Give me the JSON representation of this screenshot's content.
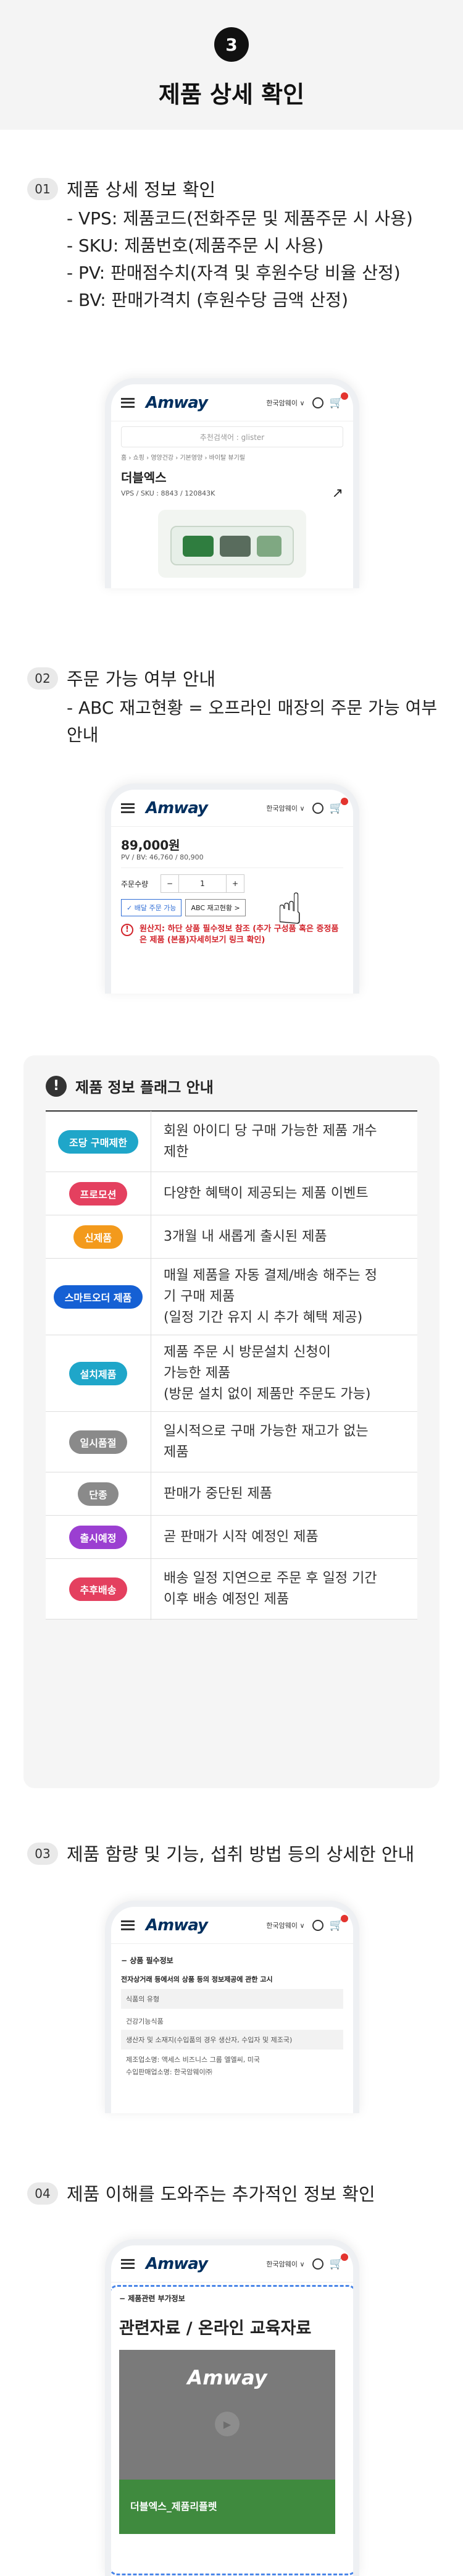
{
  "header": {
    "step": "3",
    "title": "제품 상세 확인"
  },
  "sec1": {
    "num": "01",
    "title": "제품 상세 정보 확인",
    "bullets": [
      "- VPS: 제품코드(전화주문 및 제품주문 시 사용)",
      "- SKU: 제품번호(제품주문 시 사용)",
      "- PV: 판매점수치(자격 및 후원수당 비율 산정)",
      "- BV: 판매가격치 (후원수당 금액 산정)"
    ],
    "phone": {
      "logo": "Amway",
      "lang": "한국암웨이 ∨",
      "search_placeholder": "추천검색어 : glister",
      "breadcrumb": "홈 › 쇼핑 › 영양건강 › 기본영양 › 바이탈 뷰기릴",
      "product_name": "더블엑스",
      "codes": "VPS / SKU : 8843 / 120843K"
    }
  },
  "sec2": {
    "num": "02",
    "title": "주문 가능 여부 안내",
    "bullets": [
      "- ABC 재고현황 = 오프라인 매장의 주문 가능 여부",
      "안내"
    ],
    "phone": {
      "logo": "Amway",
      "lang": "한국암웨이 ∨",
      "price": "89,000원",
      "pvbv": "PV / BV: 46,760 / 80,900",
      "qty_label": "주문수량",
      "minus": "−",
      "qty": "1",
      "plus": "+",
      "delivery": "✓ 배달 주문 가능",
      "abc_btn": "ABC 재고현황 >",
      "notice": "원산지: 하단 상품 필수정보 참조 (추가 구성품 혹은 증정품은 제품 (본품)자세히보기 링크 확인)"
    }
  },
  "flags": {
    "title": "제품 정보 플래그 안내",
    "rows": [
      {
        "label": "조당 구매제한",
        "color": "#1fa6c9",
        "desc": [
          "회원 아이디 당 구매 가능한 제품 개수",
          "제한"
        ]
      },
      {
        "label": "프로모션",
        "color": "#e4405f",
        "desc": [
          "다양한 혜택이 제공되는 제품 이벤트"
        ]
      },
      {
        "label": "신제품",
        "color": "#f39a1c",
        "desc": [
          "3개월 내 새롭게 출시된 제품"
        ]
      },
      {
        "label": "스마트오더 제품",
        "color": "#1560d4",
        "desc": [
          "매월 제품을 자동 결제/배송 해주는 정",
          "기 구매 제품",
          "(일정 기간 유지 시 추가 혜택 제공)"
        ]
      },
      {
        "label": "설치제품",
        "color": "#1fa6c9",
        "desc": [
          "제품 주문 시 방문설치 신청이",
          "가능한 제품",
          "(방문 설치 없이 제품만 주문도 가능)"
        ]
      },
      {
        "label": "일시품절",
        "color": "#8a8a8a",
        "desc": [
          "일시적으로 구매 가능한 재고가 없는",
          "제품"
        ]
      },
      {
        "label": "단종",
        "color": "#8a8a8a",
        "desc": [
          "판매가 중단된 제품"
        ]
      },
      {
        "label": "출시예정",
        "color": "#9b3fd1",
        "desc": [
          "곧 판매가 시작 예정인 제품"
        ]
      },
      {
        "label": "추후배송",
        "color": "#e4405f",
        "desc": [
          "배송 일정 지연으로 주문 후 일정 기간",
          "이후 배송 예정인 제품"
        ]
      }
    ]
  },
  "sec3": {
    "num": "03",
    "title": "제품 함량 및 기능, 섭취 방법 등의 상세한 안내",
    "phone": {
      "logo": "Amway",
      "lang": "한국암웨이 ∨",
      "acc_title": "− 상품 필수정보",
      "notice_title": "전자상거래 등에서의 상품 등의 정보제공에 관한 고시",
      "rows": [
        "식품의 유형",
        "건강기능식품",
        "생산자 및 소재지(수입품의 경우 생산자, 수입자 및 제조국)",
        "제조업소명: 액세스 비즈니스 그룹 엘엘씨, 미국",
        "수입판매업소명: 한국암웨이㈜"
      ]
    }
  },
  "sec4": {
    "num": "04",
    "title": "제품 이해를 도와주는 추가적인 정보 확인",
    "phone": {
      "logo": "Amway",
      "lang": "한국암웨이 ∨",
      "acc_title": "− 제품관련 부가정보",
      "big_title": "관련자료 / 온라인 교육자료",
      "video_logo": "Amway",
      "caption": "더블엑스_제품리플렛",
      "arrow": "›"
    }
  }
}
